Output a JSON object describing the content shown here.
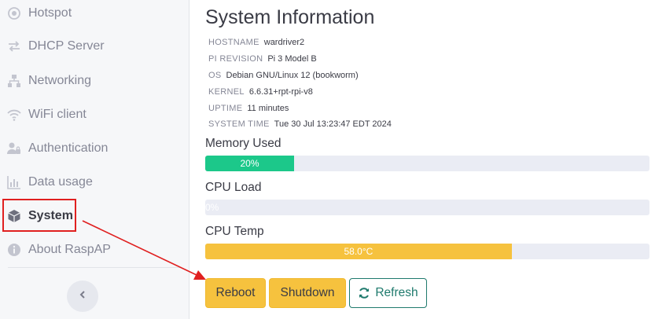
{
  "sidebar": {
    "items": [
      {
        "label": "Hotspot",
        "icon": "hotspot-icon"
      },
      {
        "label": "DHCP Server",
        "icon": "exchange-icon"
      },
      {
        "label": "Networking",
        "icon": "network-icon"
      },
      {
        "label": "WiFi client",
        "icon": "wifi-icon"
      },
      {
        "label": "Authentication",
        "icon": "user-lock-icon"
      },
      {
        "label": "Data usage",
        "icon": "chart-bar-icon"
      },
      {
        "label": "System",
        "icon": "cube-icon",
        "active": true
      },
      {
        "label": "About RaspAP",
        "icon": "info-icon"
      }
    ],
    "collapse_icon": "chevron-left-icon"
  },
  "main": {
    "title": "System Information",
    "info": [
      {
        "key": "HOSTNAME",
        "value": "wardriver2"
      },
      {
        "key": "PI REVISION",
        "value": "Pi 3 Model B"
      },
      {
        "key": "OS",
        "value": "Debian GNU/Linux 12 (bookworm)"
      },
      {
        "key": "KERNEL",
        "value": "6.6.31+rpt-rpi-v8"
      },
      {
        "key": "UPTIME",
        "value": "11 minutes"
      },
      {
        "key": "SYSTEM TIME",
        "value": "Tue 30 Jul 13:23:47 EDT 2024"
      }
    ],
    "metrics": [
      {
        "label": "Memory Used",
        "display": "20%",
        "fraction": 0.2,
        "color": "#1cc88a"
      },
      {
        "label": "CPU Load",
        "display": "0%",
        "fraction": 0.0,
        "color": "#1cc88a"
      },
      {
        "label": "CPU Temp",
        "display": "58.0°C",
        "fraction": 0.69,
        "color": "#f6c23e"
      }
    ],
    "buttons": {
      "reboot": "Reboot",
      "shutdown": "Shutdown",
      "refresh": "Refresh"
    }
  },
  "colors": {
    "accent": "#1f7a6d",
    "warning": "#f6c23e",
    "success": "#1cc88a",
    "annotation": "#e02020"
  }
}
